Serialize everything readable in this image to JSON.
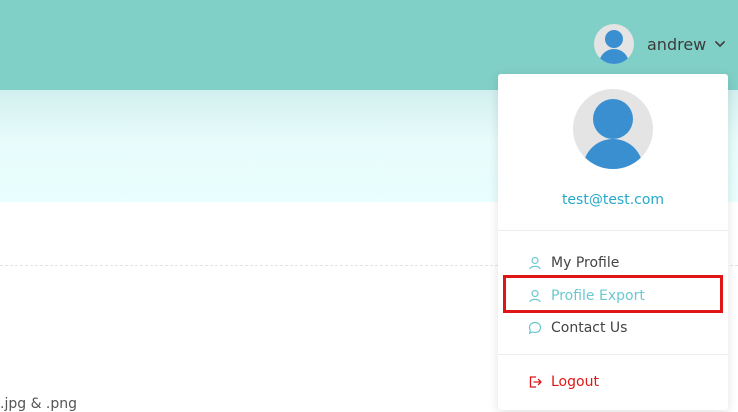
{
  "header": {
    "username": "andrew",
    "background": "#80d0c7"
  },
  "dropdown": {
    "email": "test@test.com",
    "items": [
      {
        "label": "My Profile",
        "icon": "user-icon"
      },
      {
        "label": "Profile Export",
        "icon": "user-icon",
        "state": "highlighted"
      },
      {
        "label": "Contact Us",
        "icon": "chat-bubble-icon"
      },
      {
        "label": "Logout",
        "icon": "logout-icon",
        "color": "#e01616"
      }
    ]
  },
  "content": {
    "hint_text": ".jpg & .png"
  },
  "colors": {
    "accent": "#26a9c9",
    "highlight_border": "#e01515",
    "avatar_blue": "#3a8fd1"
  }
}
